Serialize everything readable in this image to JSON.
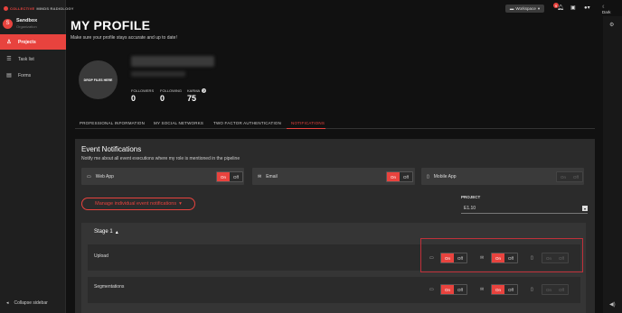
{
  "brand": {
    "part1": "COLLECTIVE",
    "part2": "MINDS RADIOLOGY"
  },
  "org": {
    "initial": "S",
    "name": "Sandbox",
    "sub": "Organization"
  },
  "nav": [
    {
      "label": "Projects",
      "icon": "person-icon"
    },
    {
      "label": "Task list",
      "icon": "list-icon"
    },
    {
      "label": "Forms",
      "icon": "forms-icon"
    }
  ],
  "collapse_label": "Collapse sidebar",
  "topbar": {
    "workspace": "Workspace",
    "notif_count": "9",
    "theme": "Dark"
  },
  "page": {
    "title": "MY PROFILE",
    "subtitle": "Make sure your profile stays accurate and up to date!"
  },
  "avatar_text": "DROP FILES HERE",
  "stats": [
    {
      "label": "FOLLOWERS",
      "value": "0"
    },
    {
      "label": "FOLLOWING",
      "value": "0"
    },
    {
      "label": "KARMA",
      "value": "75"
    }
  ],
  "tabs": [
    "PROFESSIONAL INFORMATION",
    "MY SOCIAL NETWORKS",
    "TWO FACTOR AUTHENTICATION",
    "NOTIFICATIONS"
  ],
  "events": {
    "title": "Event Notifications",
    "subtitle": "Notify me about all event executions where my role is mentioned in the pipeline",
    "channels": [
      {
        "label": "Web App",
        "icon": "monitor-icon",
        "state": "on"
      },
      {
        "label": "Email",
        "icon": "mail-icon",
        "state": "on"
      },
      {
        "label": "Mobile App",
        "icon": "mobile-icon",
        "state": "disabled"
      }
    ],
    "manage_label": "Manage individual event notifications",
    "project_label": "PROJECT",
    "project_value": "E1.10"
  },
  "toggle": {
    "on": "On",
    "off": "Off"
  },
  "stage": {
    "title": "Stage 1",
    "rows": [
      {
        "label": "Upload"
      },
      {
        "label": "Segmentations"
      }
    ]
  },
  "colors": {
    "accent": "#e8433e",
    "background": "#111111",
    "panel": "#2b2b2b"
  }
}
